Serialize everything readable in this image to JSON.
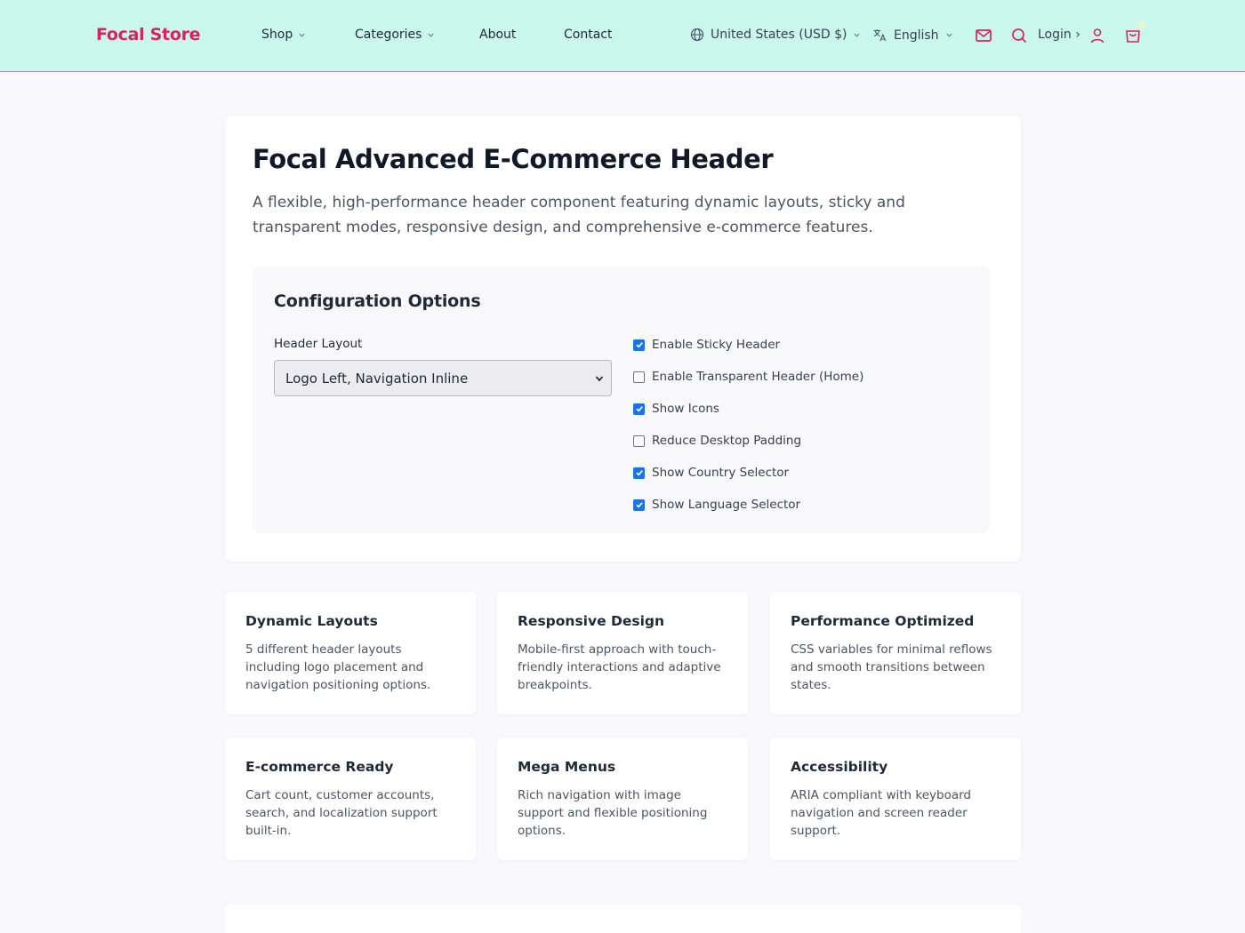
{
  "header": {
    "logo": "Focal Store",
    "nav": [
      {
        "label": "Shop"
      },
      {
        "label": "Categories"
      },
      {
        "label": "About"
      },
      {
        "label": "Contact"
      }
    ],
    "country": "United States (USD $)",
    "language": "English",
    "login": "Login ›",
    "icons": [
      "globe-icon",
      "translate-icon",
      "mail-icon",
      "search-icon",
      "user-icon",
      "cart-icon"
    ],
    "brand_color": "#d6245c",
    "background": "#c9f7ec"
  },
  "main": {
    "title": "Focal Advanced E-Commerce Header",
    "description": "A flexible, high-performance header component featuring dynamic layouts, sticky and transparent modes, responsive design, and comprehensive e-commerce features."
  },
  "config": {
    "title": "Configuration Options",
    "layout_label": "Header Layout",
    "layout_value": "Logo Left, Navigation Inline",
    "options": [
      {
        "label": "Enable Sticky Header",
        "checked": true
      },
      {
        "label": "Enable Transparent Header (Home)",
        "checked": false
      },
      {
        "label": "Show Icons",
        "checked": true
      },
      {
        "label": "Reduce Desktop Padding",
        "checked": false
      },
      {
        "label": "Show Country Selector",
        "checked": true
      },
      {
        "label": "Show Language Selector",
        "checked": true
      }
    ]
  },
  "features": [
    {
      "title": "Dynamic Layouts",
      "text": "5 different header layouts including logo placement and navigation positioning options."
    },
    {
      "title": "Responsive Design",
      "text": "Mobile-first approach with touch-friendly interactions and adaptive breakpoints."
    },
    {
      "title": "Performance Optimized",
      "text": "CSS variables for minimal reflows and smooth transitions between states."
    },
    {
      "title": "E-commerce Ready",
      "text": "Cart count, customer accounts, search, and localization support built-in."
    },
    {
      "title": "Mega Menus",
      "text": "Rich navigation with image support and flexible positioning options."
    },
    {
      "title": "Accessibility",
      "text": "ARIA compliant with keyboard navigation and screen reader support."
    }
  ]
}
